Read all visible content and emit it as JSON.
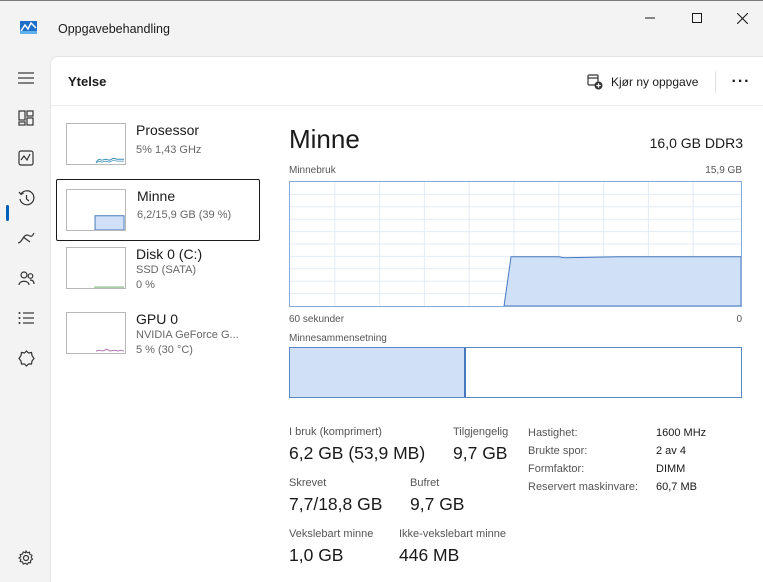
{
  "window": {
    "title": "Oppgavebehandling",
    "accent_color": "#005fb8",
    "icons": {
      "minimize": "minimize-icon",
      "maximize": "maximize-icon",
      "close": "close-icon"
    }
  },
  "nav": {
    "items": [
      {
        "name": "hamburger-menu-icon"
      },
      {
        "name": "processes-icon"
      },
      {
        "name": "performance-icon",
        "selected": true
      },
      {
        "name": "app-history-icon"
      },
      {
        "name": "startup-apps-icon"
      },
      {
        "name": "users-icon"
      },
      {
        "name": "details-icon"
      },
      {
        "name": "services-icon"
      }
    ],
    "settings": {
      "name": "settings-icon"
    }
  },
  "header": {
    "title": "Ytelse",
    "new_task_label": "Kjør ny oppgave",
    "more_label": "···"
  },
  "perf_items": [
    {
      "name": "Prosessor",
      "line1": "5%  1,43 GHz",
      "line2": "",
      "selected": false
    },
    {
      "name": "Minne",
      "line1": "6,2/15,9 GB (39 %)",
      "line2": "",
      "selected": true
    },
    {
      "name": "Disk 0 (C:)",
      "line1": "SSD (SATA)",
      "line2": "0 %",
      "selected": false
    },
    {
      "name": "GPU 0",
      "line1": "NVIDIA GeForce G...",
      "line2": "5 % (30 °C)",
      "selected": false
    }
  ],
  "memory": {
    "title": "Minne",
    "spec": "16,0 GB DDR3",
    "usage_label": "Minnebruk",
    "usage_max": "15,9 GB",
    "time_label": "60 sekunder",
    "time_end": "0",
    "composition_label": "Minnesammensetning",
    "in_use_fraction": 0.39,
    "graph_fill_color": "#cfe0f7",
    "graph_line_color": "#4778bd",
    "stats": {
      "in_use_label": "I bruk (komprimert)",
      "in_use_value": "6,2 GB (53,9 MB)",
      "available_label": "Tilgjengelig",
      "available_value": "9,7 GB",
      "committed_label": "Skrevet",
      "committed_value": "7,7/18,8 GB",
      "cached_label": "Bufret",
      "cached_value": "9,7 GB",
      "paged_label": "Vekslebart minne",
      "paged_value": "1,0 GB",
      "nonpaged_label": "Ikke-vekslebart minne",
      "nonpaged_value": "446 MB"
    },
    "properties": [
      {
        "key": "Hastighet:",
        "value": "1600 MHz"
      },
      {
        "key": "Brukte spor:",
        "value": "2 av 4"
      },
      {
        "key": "Formfaktor:",
        "value": "DIMM"
      },
      {
        "key": "Reservert maskinvare:",
        "value": "60,7 MB"
      }
    ]
  }
}
